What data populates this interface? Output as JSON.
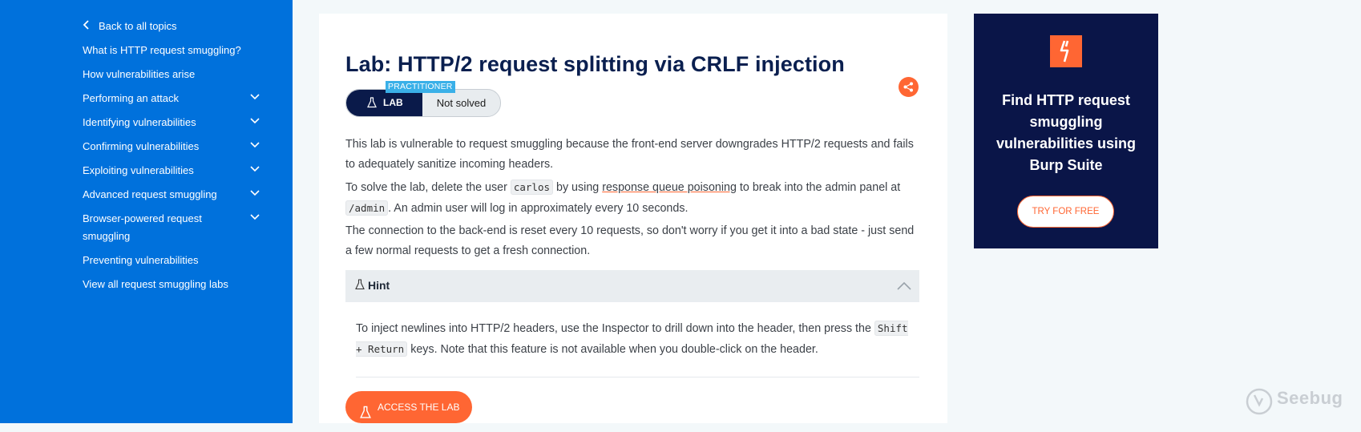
{
  "sidebar": {
    "back_label": "Back to all topics",
    "items": [
      {
        "label": "What is HTTP request smuggling?",
        "expandable": false
      },
      {
        "label": "How vulnerabilities arise",
        "expandable": false
      },
      {
        "label": "Performing an attack",
        "expandable": true
      },
      {
        "label": "Identifying vulnerabilities",
        "expandable": true
      },
      {
        "label": "Confirming vulnerabilities",
        "expandable": true
      },
      {
        "label": "Exploiting vulnerabilities",
        "expandable": true
      },
      {
        "label": "Advanced request smuggling",
        "expandable": true
      },
      {
        "label": "Browser-powered request smuggling",
        "expandable": true
      },
      {
        "label": "Preventing vulnerabilities",
        "expandable": false
      },
      {
        "label": "View all request smuggling labs",
        "expandable": false
      }
    ]
  },
  "main": {
    "title": "Lab: HTTP/2 request splitting via CRLF injection",
    "badge_level": "PRACTITIONER",
    "badge_lab": "LAB",
    "badge_status": "Not solved",
    "para1": "This lab is vulnerable to request smuggling because the front-end server downgrades HTTP/2 requests and fails to adequately sanitize incoming headers.",
    "para2": {
      "t1": "To solve the lab, delete the user ",
      "code1": "carlos",
      "t2": " by using ",
      "link": "response queue poisoning",
      "t3": " to break into the admin panel at ",
      "code2": "/admin",
      "t4": ". An admin user will log in approximately every 10 seconds."
    },
    "para3": "The connection to the back-end is reset every 10 requests, so don't worry if you get it into a bad state - just send a few normal requests to get a fresh connection.",
    "hint": {
      "label": "Hint",
      "t1": "To inject newlines into HTTP/2 headers, use the Inspector to drill down into the header, then press the ",
      "code": "Shift + Return",
      "t2": " keys. Note that this feature is not available when you double-click on the header."
    },
    "access_button": "ACCESS THE LAB"
  },
  "ad": {
    "title": "Find HTTP request smuggling vulnerabilities using Burp Suite",
    "button": "TRY FOR FREE"
  },
  "watermark": "Seebug",
  "colors": {
    "sidebar_bg": "#0071dc",
    "accent": "#ff6633",
    "navy": "#0a1a4a",
    "practitioner": "#3ab0e8"
  }
}
